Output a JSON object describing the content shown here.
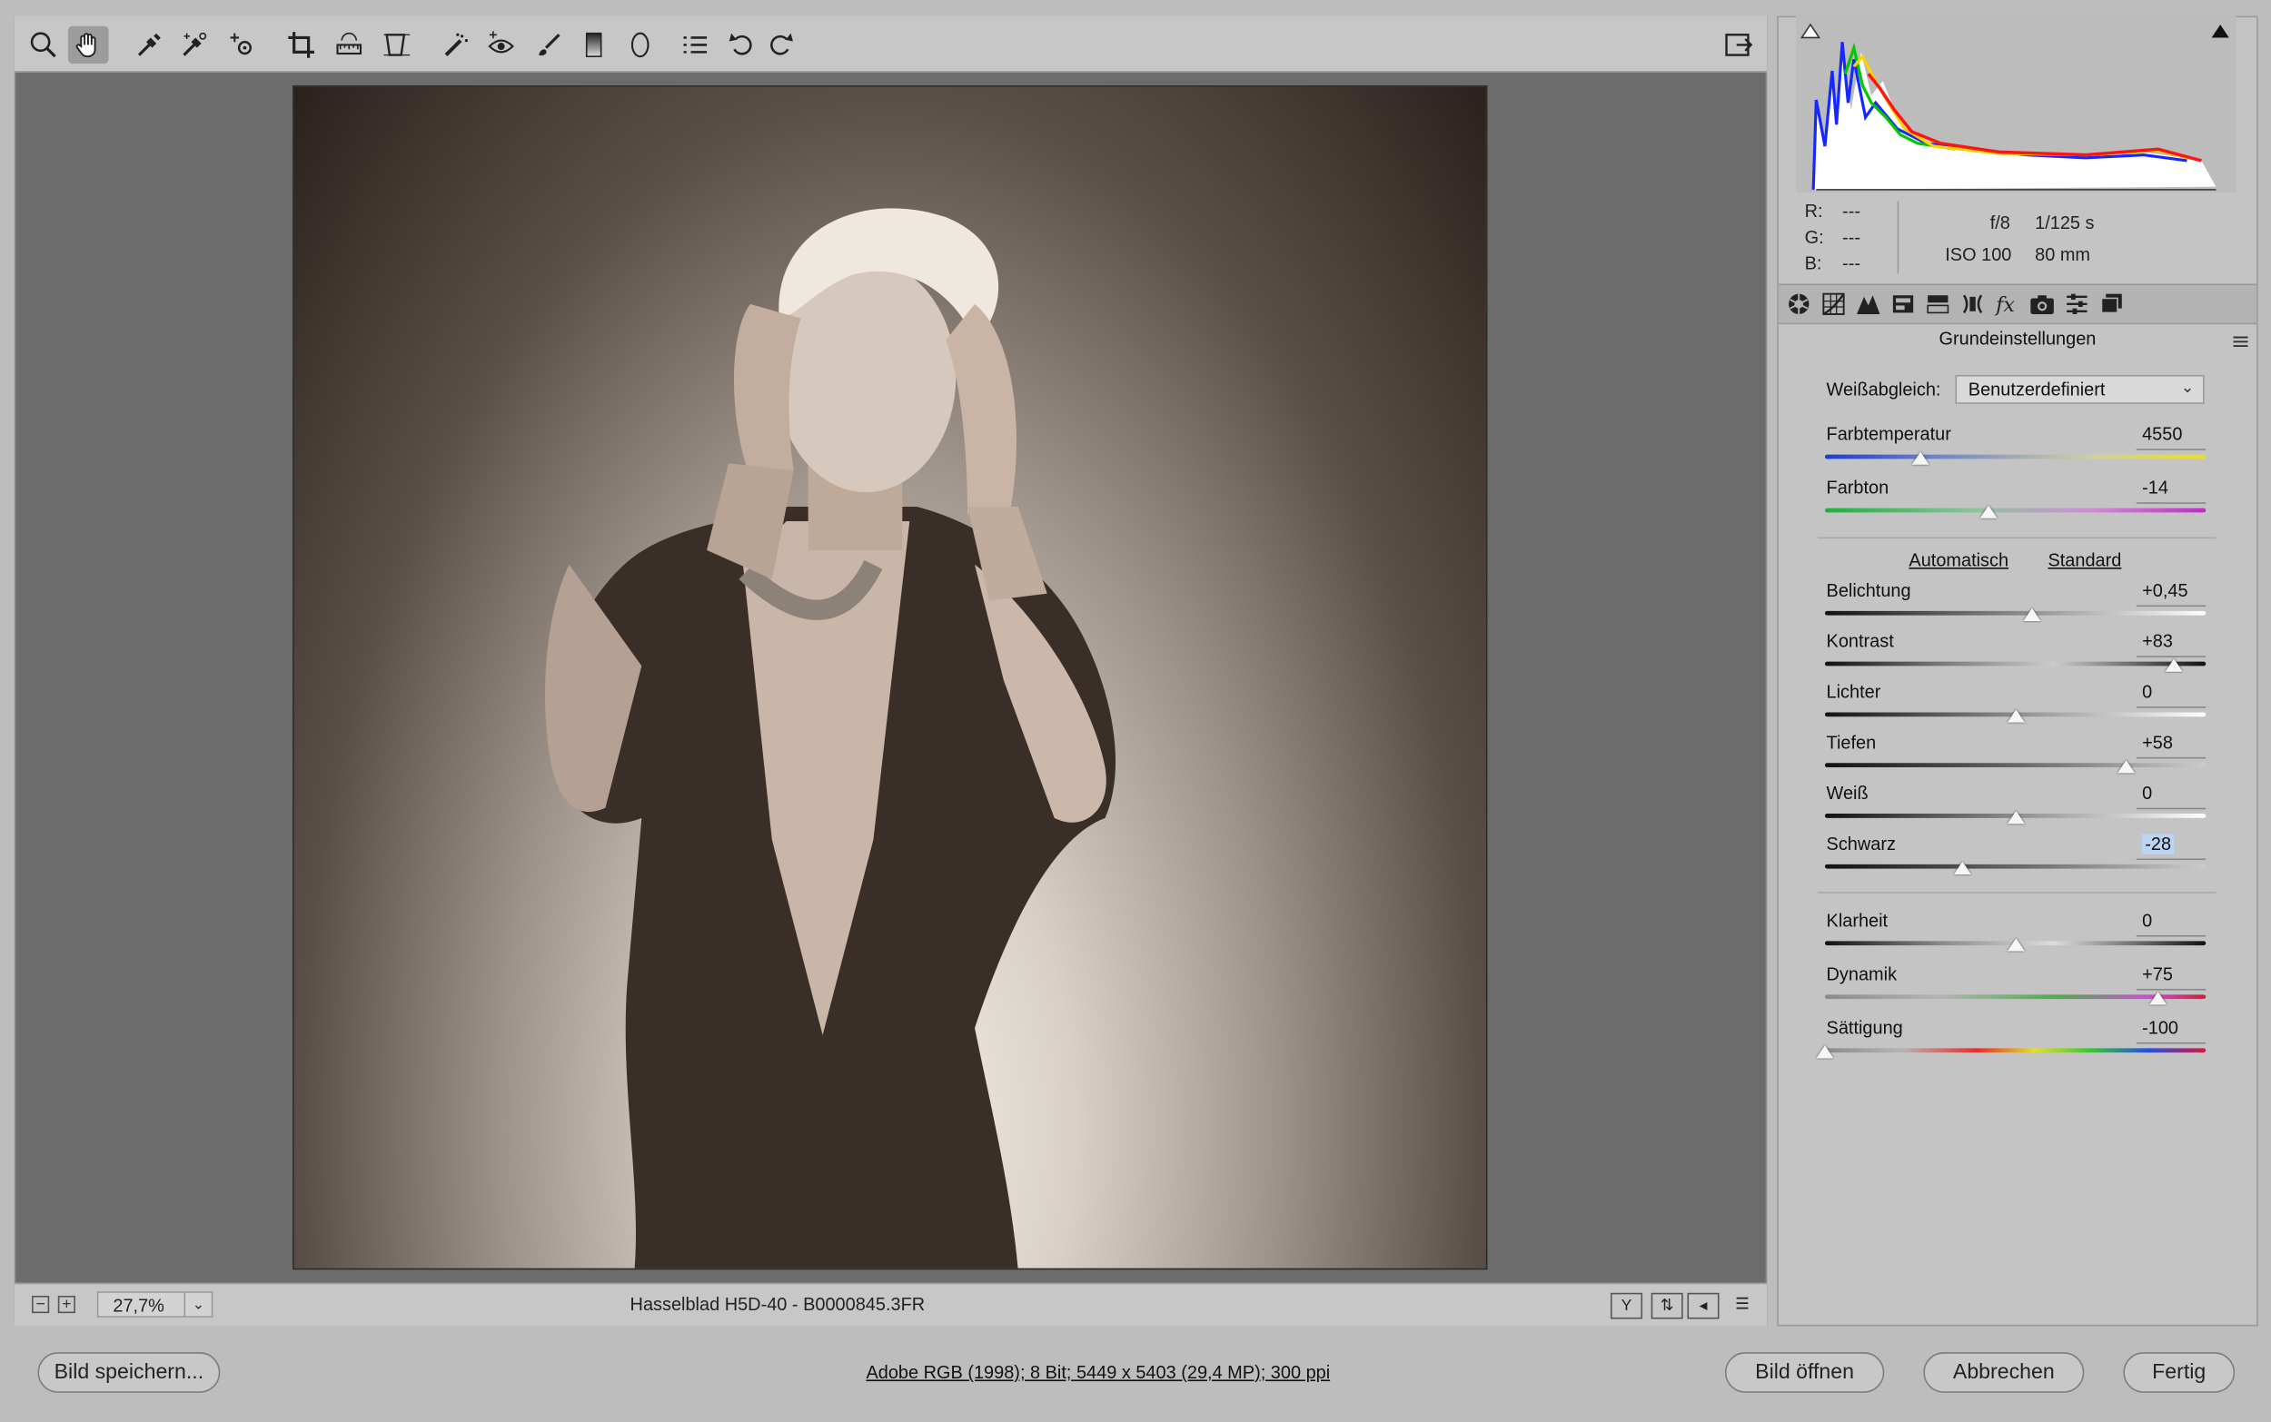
{
  "toolbar": {
    "tools": [
      "zoom-icon",
      "hand-icon",
      "white-balance-icon",
      "color-sampler-icon",
      "targeted-adjustment-icon",
      "crop-icon",
      "straighten-icon",
      "transform-icon",
      "spot-removal-icon",
      "red-eye-icon",
      "adjustment-brush-icon",
      "graduated-filter-icon",
      "radial-filter-icon",
      "preferences-icon",
      "rotate-left-icon",
      "rotate-right-icon"
    ],
    "fullscreen_icon": "toggle-fullscreen-icon"
  },
  "status": {
    "zoom_value": "27,7%",
    "filename": "Hasselblad H5D-40 - B0000845.3FR",
    "view_icons": [
      "before-after-icon",
      "swap-icon",
      "copy-settings-icon",
      "settings-icon"
    ]
  },
  "histogram": {
    "r_label": "R:",
    "r_value": "---",
    "g_label": "G:",
    "g_value": "---",
    "b_label": "B:",
    "b_value": "---",
    "aperture": "f/8",
    "shutter": "1/125 s",
    "iso": "ISO 100",
    "focal": "80 mm"
  },
  "panel": {
    "section_title": "Grundeinstellungen",
    "tabs": [
      "basic-tab-icon",
      "tone-curve-tab-icon",
      "detail-tab-icon",
      "hsl-tab-icon",
      "split-toning-tab-icon",
      "lens-tab-icon",
      "effects-tab-icon",
      "camera-calibration-tab-icon",
      "presets-tab-icon",
      "snapshots-tab-icon"
    ],
    "white_balance_label": "Weißabgleich:",
    "white_balance_value": "Benutzerdefiniert",
    "auto_link": "Automatisch",
    "default_link": "Standard",
    "sliders": [
      {
        "label": "Farbtemperatur",
        "value": "4550",
        "pos": 0.25
      },
      {
        "label": "Farbton",
        "value": "-14",
        "pos": 0.43
      },
      {
        "label": "Belichtung",
        "value": "+0,45",
        "pos": 0.545
      },
      {
        "label": "Kontrast",
        "value": "+83",
        "pos": 0.915
      },
      {
        "label": "Lichter",
        "value": "0",
        "pos": 0.5
      },
      {
        "label": "Tiefen",
        "value": "+58",
        "pos": 0.79
      },
      {
        "label": "Weiß",
        "value": "0",
        "pos": 0.5
      },
      {
        "label": "Schwarz",
        "value": "-28",
        "pos": 0.36
      },
      {
        "label": "Klarheit",
        "value": "0",
        "pos": 0.5
      },
      {
        "label": "Dynamik",
        "value": "+75",
        "pos": 0.875
      },
      {
        "label": "Sättigung",
        "value": "-100",
        "pos": 0.0
      }
    ]
  },
  "footer": {
    "save_button": "Bild speichern...",
    "info": "Adobe RGB (1998); 8 Bit; 5449 x 5403 (29,4 MP); 300 ppi",
    "open_button": "Bild öffnen",
    "cancel_button": "Abbrechen",
    "done_button": "Fertig"
  },
  "colors": {
    "highlight": "#bcd4f3"
  }
}
